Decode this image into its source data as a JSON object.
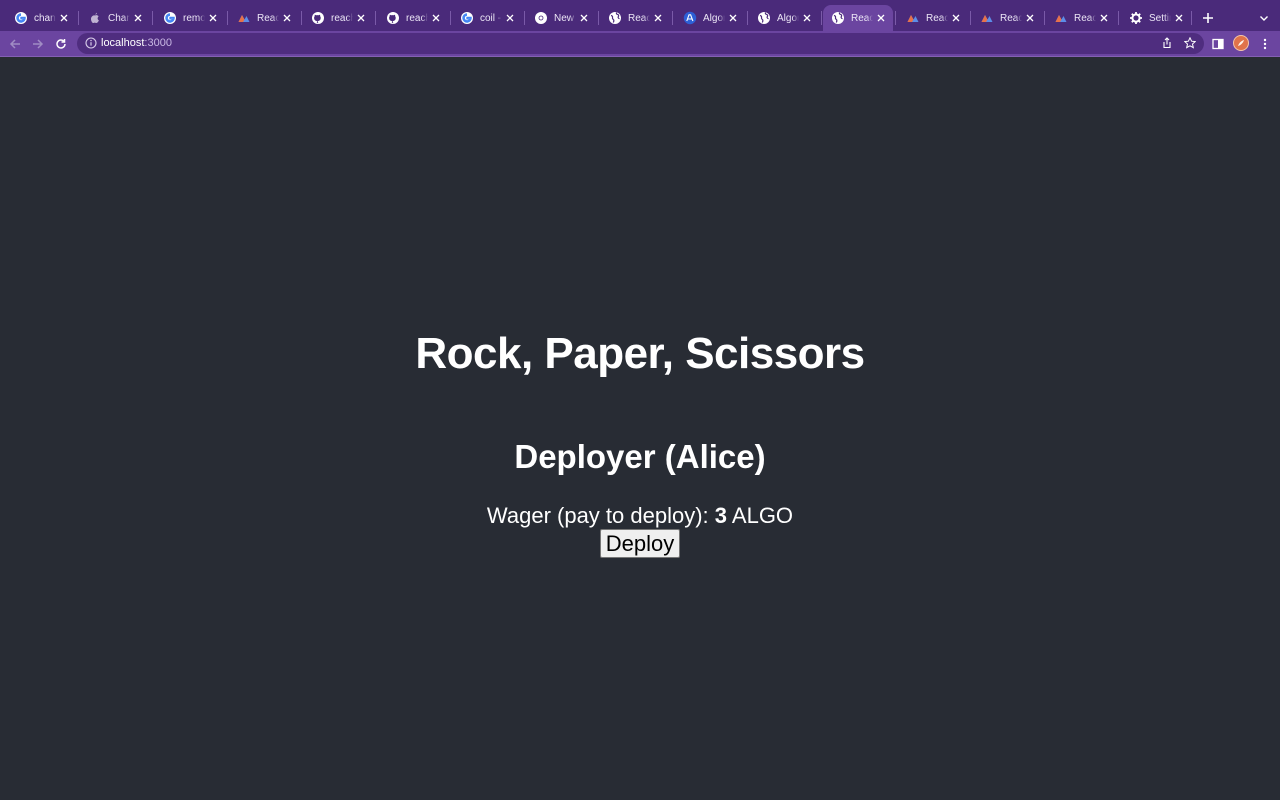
{
  "browser": {
    "tabs": [
      {
        "title": "change",
        "icon": "google-icon",
        "active": false
      },
      {
        "title": "Change",
        "icon": "apple-icon",
        "active": false
      },
      {
        "title": "remove",
        "icon": "google-icon",
        "active": false
      },
      {
        "title": "Reach",
        "icon": "reach-icon",
        "active": false
      },
      {
        "title": "reach-l",
        "icon": "github-icon",
        "active": false
      },
      {
        "title": "reach-l",
        "icon": "github-icon",
        "active": false
      },
      {
        "title": "coil - G",
        "icon": "google-icon",
        "active": false
      },
      {
        "title": "New Ta",
        "icon": "chrome-icon",
        "active": false
      },
      {
        "title": "Reach",
        "icon": "globe-icon",
        "active": false
      },
      {
        "title": "Algoran",
        "icon": "algorand-icon",
        "active": false
      },
      {
        "title": "Algoran",
        "icon": "globe-icon",
        "active": false
      },
      {
        "title": "Reach",
        "icon": "globe-icon",
        "active": true
      },
      {
        "title": "Reach",
        "icon": "reach-icon",
        "active": false
      },
      {
        "title": "Reach",
        "icon": "reach-icon",
        "active": false
      },
      {
        "title": "Reach",
        "icon": "reach-icon",
        "active": false
      },
      {
        "title": "Setting",
        "icon": "gear-icon",
        "active": false
      }
    ],
    "address": {
      "host": "localhost",
      "port": ":3000"
    },
    "colors": {
      "frame": "#4a2a7a",
      "toolbar": "#6b45a0",
      "omnibox": "#4f2d7f"
    }
  },
  "page": {
    "title": "Rock, Paper, Scissors",
    "subtitle": "Deployer (Alice)",
    "wager_label": "Wager (pay to deploy): ",
    "wager_amount": "3",
    "wager_unit": " ALGO",
    "deploy_label": "Deploy",
    "background": "#282c34"
  }
}
